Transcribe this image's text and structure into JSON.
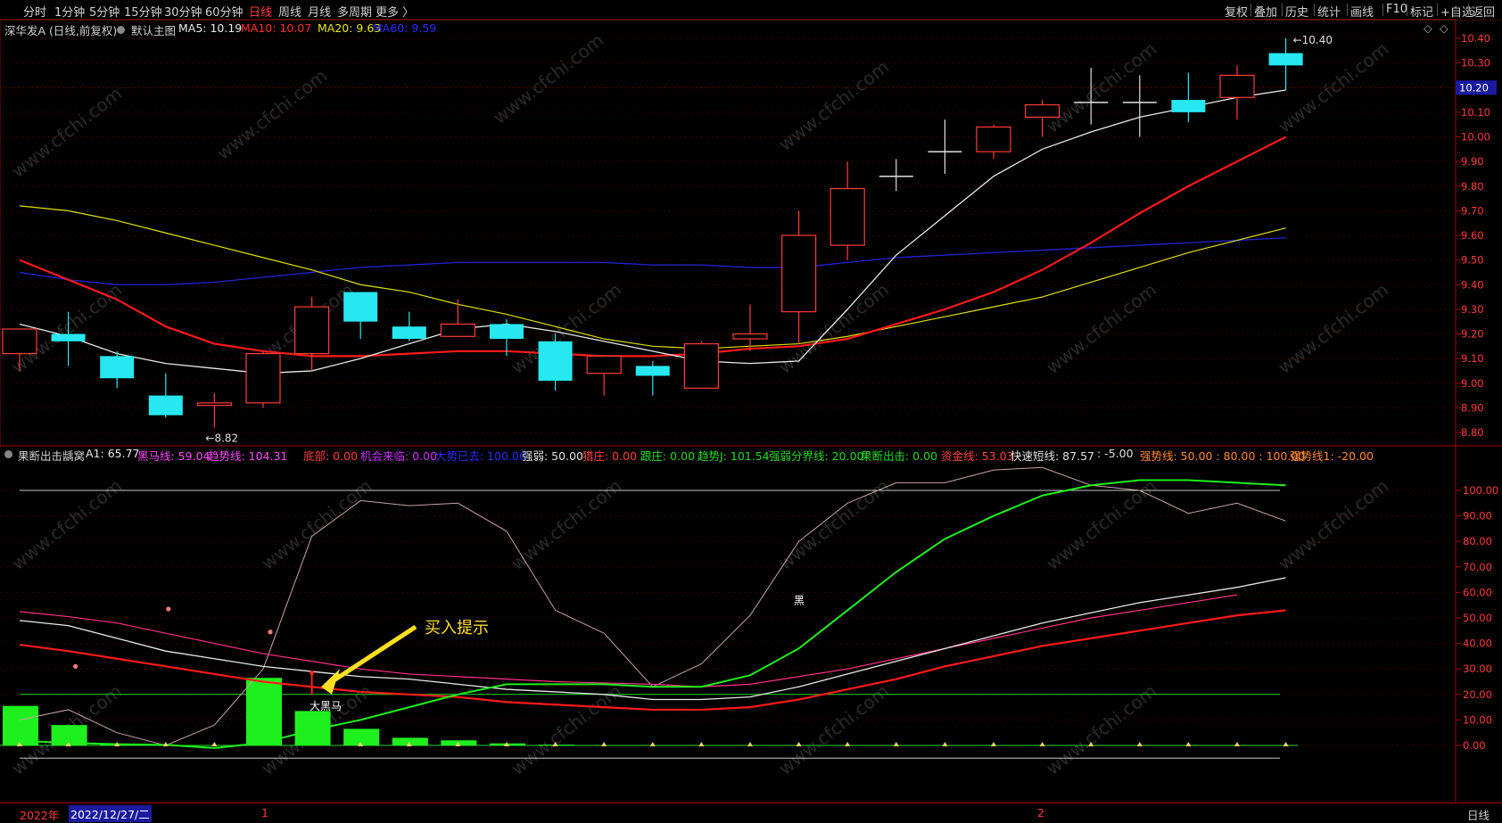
{
  "toolbar": {
    "periods": [
      "分时",
      "1分钟",
      "5分钟",
      "15分钟",
      "30分钟",
      "60分钟",
      "日线",
      "周线",
      "月线",
      "多周期",
      "更多 〉"
    ],
    "active_period": "日线",
    "right_buttons": [
      "复权",
      "叠加",
      "历史",
      "统计",
      "画线",
      "F10",
      "标记",
      "+自选",
      "返回"
    ]
  },
  "main_header": {
    "stock": "深华发A (日线,前复权)",
    "chart_name": "默认主图",
    "ma5": "MA5: 10.19",
    "ma10": "MA10: 10.07",
    "ma20": "MA20: 9.63",
    "ma60": "MA60: 9.59",
    "diamond_icons": [
      "◇",
      "◇"
    ]
  },
  "price_axis": {
    "labels": [
      "10.40",
      "10.30",
      "10.20",
      "10.10",
      "10.00",
      "9.90",
      "9.80",
      "9.70",
      "9.60",
      "9.50",
      "9.40",
      "9.30",
      "9.20",
      "9.10",
      "9.00",
      "8.90",
      "8.80"
    ],
    "current_price": "10.20",
    "high_marker": "10.40",
    "low_marker": "8.82"
  },
  "indicator_header": {
    "name": "果断出击龋窝",
    "a1": "A1: 65.77",
    "heima": "黑马线: 59.04",
    "qushi": "趋势线: 104.31",
    "dibu": "底部: 0.00",
    "jihui": "机会来临: 0.00",
    "dashi": "大势已去: 100.00",
    "qiangruo": "强弱: 50.00",
    "liezhuang": "猎庄: 0.00",
    "genzhuang": "跟庄: 0.00",
    "qushij": "趋势J: 101.54",
    "fenjie": "强弱分界线: 20.00",
    "guoduan": "果断出击: 0.00",
    "zijin": "资金线: 53.03",
    "kuaisu": "快速短线: 87.57",
    "neg": ": -5.00",
    "qiangshi": "强势线: 50.00 : 80.00 : 100.00",
    "qiangshi1": "强势线1: -20.00"
  },
  "indicator_axis": {
    "labels": [
      "100.00",
      "90.00",
      "80.00",
      "70.00",
      "60.00",
      "50.00",
      "40.00",
      "30.00",
      "20.00",
      "10.00",
      "0.00"
    ]
  },
  "annotations": {
    "buy_hint": "买入提示",
    "dark_horse": "大黑马",
    "hei": "黑"
  },
  "bottom": {
    "year": "2022年",
    "date": "2022/12/27/二",
    "month1": "1",
    "month2": "2",
    "period": "日线"
  },
  "watermark": "www.cfchi.com",
  "chart_data": {
    "type": "candlestick",
    "candles": [
      {
        "o": 9.12,
        "h": 9.22,
        "l": 9.05,
        "c": 9.22
      },
      {
        "o": 9.2,
        "h": 9.29,
        "l": 9.07,
        "c": 9.17
      },
      {
        "o": 9.11,
        "h": 9.13,
        "l": 8.98,
        "c": 9.02
      },
      {
        "o": 8.95,
        "h": 9.04,
        "l": 8.86,
        "c": 8.87
      },
      {
        "o": 8.91,
        "h": 8.96,
        "l": 8.82,
        "c": 8.92
      },
      {
        "o": 8.92,
        "h": 9.13,
        "l": 8.9,
        "c": 9.12
      },
      {
        "o": 9.12,
        "h": 9.35,
        "l": 9.05,
        "c": 9.31
      },
      {
        "o": 9.37,
        "h": 9.37,
        "l": 9.18,
        "c": 9.25
      },
      {
        "o": 9.23,
        "h": 9.29,
        "l": 9.17,
        "c": 9.18
      },
      {
        "o": 9.19,
        "h": 9.34,
        "l": 9.19,
        "c": 9.24
      },
      {
        "o": 9.24,
        "h": 9.26,
        "l": 9.11,
        "c": 9.18
      },
      {
        "o": 9.17,
        "h": 9.2,
        "l": 8.97,
        "c": 9.01
      },
      {
        "o": 9.04,
        "h": 9.09,
        "l": 8.95,
        "c": 9.11
      },
      {
        "o": 9.07,
        "h": 9.09,
        "l": 8.95,
        "c": 9.03
      },
      {
        "o": 8.98,
        "h": 9.17,
        "l": 8.98,
        "c": 9.16
      },
      {
        "o": 9.18,
        "h": 9.32,
        "l": 9.13,
        "c": 9.2
      },
      {
        "o": 9.29,
        "h": 9.7,
        "l": 9.16,
        "c": 9.6
      },
      {
        "o": 9.56,
        "h": 9.9,
        "l": 9.5,
        "c": 9.79
      },
      {
        "o": 9.84,
        "h": 9.91,
        "l": 9.78,
        "c": 9.84
      },
      {
        "o": 9.94,
        "h": 10.07,
        "l": 9.85,
        "c": 9.94
      },
      {
        "o": 9.94,
        "h": 10.05,
        "l": 9.91,
        "c": 10.04
      },
      {
        "o": 10.08,
        "h": 10.15,
        "l": 10.0,
        "c": 10.13
      },
      {
        "o": 10.14,
        "h": 10.28,
        "l": 10.05,
        "c": 10.14
      },
      {
        "o": 10.14,
        "h": 10.25,
        "l": 10.0,
        "c": 10.14
      },
      {
        "o": 10.15,
        "h": 10.26,
        "l": 10.06,
        "c": 10.1
      },
      {
        "o": 10.16,
        "h": 10.29,
        "l": 10.07,
        "c": 10.25
      },
      {
        "o": 10.34,
        "h": 10.4,
        "l": 10.19,
        "c": 10.29
      }
    ],
    "ma5": [
      9.24,
      9.19,
      9.12,
      9.08,
      9.06,
      9.04,
      9.05,
      9.1,
      9.16,
      9.22,
      9.24,
      9.21,
      9.17,
      9.13,
      9.09,
      9.08,
      9.09,
      9.3,
      9.52,
      9.68,
      9.84,
      9.95,
      10.02,
      10.08,
      10.12,
      10.16,
      10.19
    ],
    "ma10": [
      9.5,
      9.42,
      9.34,
      9.23,
      9.16,
      9.13,
      9.11,
      9.11,
      9.12,
      9.13,
      9.13,
      9.12,
      9.11,
      9.11,
      9.12,
      9.14,
      9.15,
      9.18,
      9.24,
      9.3,
      9.37,
      9.46,
      9.57,
      9.69,
      9.8,
      9.9,
      10.0,
      10.07
    ],
    "ma20": [
      9.72,
      9.7,
      9.66,
      9.61,
      9.56,
      9.51,
      9.46,
      9.4,
      9.37,
      9.32,
      9.28,
      9.23,
      9.18,
      9.15,
      9.14,
      9.15,
      9.16,
      9.19,
      9.23,
      9.27,
      9.31,
      9.35,
      9.41,
      9.47,
      9.53,
      9.58,
      9.63
    ],
    "ma60": [
      9.45,
      9.42,
      9.4,
      9.4,
      9.41,
      9.43,
      9.45,
      9.47,
      9.48,
      9.49,
      9.49,
      9.49,
      9.49,
      9.48,
      9.48,
      9.47,
      9.47,
      9.49,
      9.51,
      9.52,
      9.53,
      9.54,
      9.55,
      9.56,
      9.57,
      9.58,
      9.59
    ],
    "ind_bars": [
      15.5,
      8,
      0.5,
      0,
      0,
      26.5,
      13.5,
      6.5,
      3,
      2,
      0.8,
      0.3,
      0,
      0,
      0,
      0,
      0,
      0,
      0,
      0,
      0,
      0,
      0,
      0,
      0,
      0,
      0
    ],
    "ind_pink": [
      null,
      null,
      null,
      null,
      null,
      null,
      null,
      null,
      null,
      null,
      null,
      null,
      null,
      23,
      32,
      51,
      80,
      95,
      103,
      103,
      108,
      109,
      102,
      100,
      91,
      95,
      88
    ],
    "ind_pink_early": [
      10,
      14,
      5,
      0,
      8,
      30,
      82,
      96,
      94,
      95,
      84,
      53,
      44,
      23
    ],
    "ind_green": [
      1.8,
      1,
      0.5,
      0.2,
      -1,
      1,
      6,
      10,
      15,
      20,
      24,
      24,
      24,
      23,
      23,
      27.5,
      38,
      53,
      68,
      81,
      90,
      98,
      102,
      104,
      104,
      103,
      102
    ],
    "ind_white": [
      49,
      47,
      42,
      37,
      34,
      31,
      29,
      27,
      26,
      24,
      22,
      21,
      20,
      18,
      18,
      19,
      23,
      28,
      33,
      38,
      43,
      48,
      52,
      56,
      59,
      62,
      65.77
    ],
    "ind_red": [
      39.5,
      37,
      34,
      31,
      28,
      25,
      23,
      21,
      20,
      19,
      17,
      16,
      15,
      14,
      14,
      15,
      18,
      22,
      26,
      31,
      35,
      39,
      42,
      45,
      48,
      51,
      53
    ],
    "ind_magenta": [
      52.5,
      50.5,
      48,
      44,
      40,
      36,
      33,
      30,
      28,
      27,
      26,
      25,
      24.5,
      24,
      23,
      24,
      27,
      30,
      34,
      38,
      42,
      46,
      50,
      53,
      56,
      59.04
    ],
    "ind_dots": [
      null,
      31,
      null,
      53.5,
      null,
      44.5
    ]
  }
}
